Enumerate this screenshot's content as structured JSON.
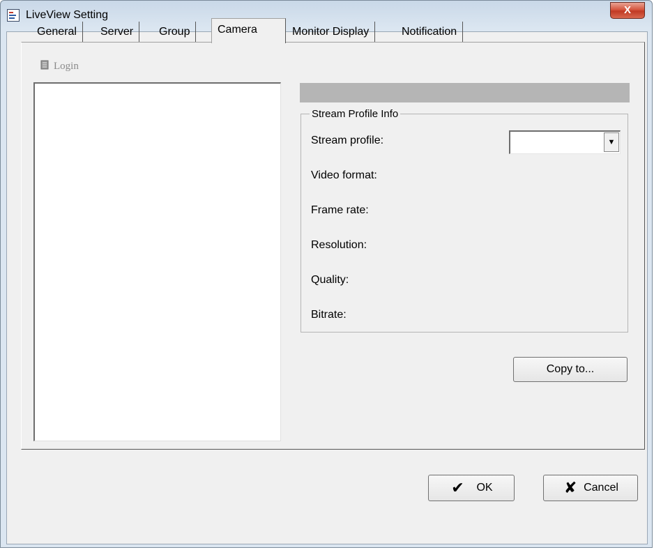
{
  "window": {
    "title": "LiveView Setting",
    "close_glyph": "X",
    "icon": "app-settings-icon"
  },
  "tabs": [
    {
      "label": "General",
      "active": false
    },
    {
      "label": "Server",
      "active": false
    },
    {
      "label": "Group",
      "active": false
    },
    {
      "label": "Camera",
      "active": true
    },
    {
      "label": "Monitor Display",
      "active": false
    },
    {
      "label": "Notification",
      "active": false
    }
  ],
  "login": {
    "label": "Login",
    "icon": "login-icon",
    "enabled": false
  },
  "stream_info": {
    "legend": "Stream Profile Info",
    "stream_profile_label": "Stream profile:",
    "stream_profile_value": "",
    "video_format_label": "Video format:",
    "frame_rate_label": "Frame rate:",
    "resolution_label": "Resolution:",
    "quality_label": "Quality:",
    "bitrate_label": "Bitrate:"
  },
  "buttons": {
    "copy_to": "Copy to...",
    "ok": "OK",
    "ok_glyph": "✔",
    "cancel": "Cancel",
    "cancel_glyph": "✘"
  },
  "colors": {
    "close_button": "#c03a24",
    "header_bar": "#b5b5b5"
  }
}
